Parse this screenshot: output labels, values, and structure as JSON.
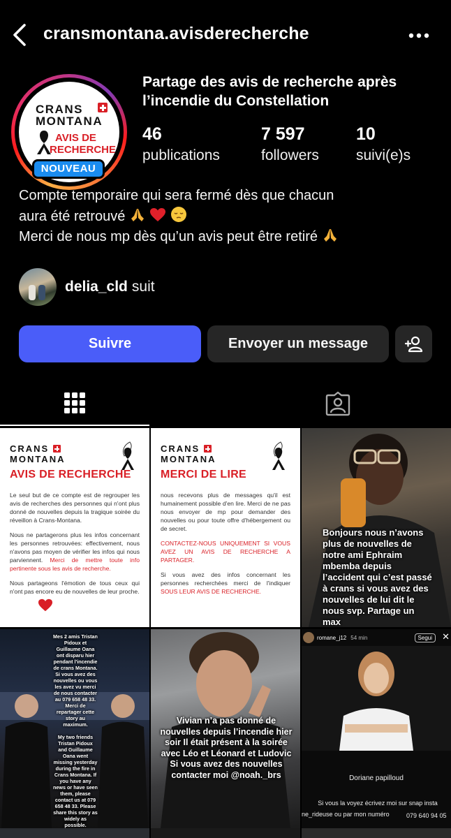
{
  "header": {
    "username": "cransmontana.avisderecherche"
  },
  "profile": {
    "logo_line1": "CRANS",
    "logo_line2": "MONTANA",
    "logo_line3": "AVIS DE",
    "logo_line4": "RECHERCHE",
    "new_badge": "NOUVEAU",
    "display_name": "Partage des avis de recherche après l’incendie du Constellation",
    "stats": {
      "posts_count": "46",
      "posts_label": "publications",
      "followers_count": "7 597",
      "followers_label": "followers",
      "following_count": "10",
      "following_label": "suivi(e)s"
    },
    "bio_line1": "Compte temporaire qui sera fermé dès que chacun",
    "bio_line2": "aura été retrouvé",
    "bio_line3": "Merci de nous mp dès qu’un avis peut être retiré",
    "followed_by_name": "delia_cld",
    "followed_by_suffix": "suit"
  },
  "actions": {
    "follow": "Suivre",
    "message": "Envoyer un message"
  },
  "posts": {
    "p1": {
      "line1": "CRANS",
      "line2": "MONTANA",
      "title": "AVIS DE RECHERCHE",
      "para1": "Le seul but de ce compte est de regrouper les avis de recherches des personnes qui n'ont plus donné de nouvelles depuis la tragique soirée du réveillon à Crans-Montana.",
      "para2a": "Nous ne partagerons plus les infos concernant les personnes retrouvées: effectivement, nous n'avons pas moyen de vérifier les infos qui nous parviennent.",
      "para2b": "Merci de mettre toute info pertinente sous les avis de recherche.",
      "para3": "Nous partageons l'émotion de tous ceux qui n'ont pas encore eu de nouvelles de leur proche."
    },
    "p2": {
      "line1": "CRANS",
      "line2": "MONTANA",
      "title": "MERCI DE LIRE",
      "para1": "nous recevons plus de messages qu'il est humainement possible d'en lire. Merci de ne pas nous envoyer de mp pour demander des nouvelles ou pour toute offre d'hébergement ou de secret.",
      "para2": "CONTACTEZ-NOUS UNIQUEMENT SI VOUS AVEZ UN AVIS DE RECHERCHE A PARTAGER.",
      "para3a": "Si vous avez des infos concernant les personnes recherchées merci de l'indiquer",
      "para3b": "SOUS LEUR AVIS DE RECHERCHE."
    },
    "p3": {
      "caption": "Bonjours nous n’avons plus de nouvelles de notre ami Ephraim mbemba depuis l’accident qui c’est passé à crans si vous avez des nouvelles de lui dit le nous svp. Partage un max"
    },
    "p4": {
      "caption_fr": "Mes 2 amis Tristan Pidoux et Guillaume Oana ont disparu hier pendant l'incendie de crans Montana. Si vous avez des nouvelles ou vous les avez vu merci de nous contacter au 079 658 48 33. Merci de repartager cette story au maximum.",
      "caption_en": "My two friends Tristan Pidoux and Guillaume Oana went missing yesterday during the fire in Crans Montana. If you have any news or have seen them, please contact us at 079 658 48 33. Please share this story as widely as possible."
    },
    "p5": {
      "caption": "Vivian n’a pas donné de nouvelles depuis l’incendie hier soir Il était présent à la soirée avec Léo et Léonard et Ludovic Si vous avez des nouvelles contacter moi @noah._brs"
    },
    "p6": {
      "story_user": "romane_j12",
      "story_time": "54 min",
      "follow_label": "Segui",
      "name": "Doriane papilloud",
      "caption1": "Si vous la voyez écrivez moi sur snap insta",
      "caption2": "ne_rideuse ou par mon numéro",
      "phone": "079 640 94 05"
    }
  },
  "colors": {
    "background": "#000000",
    "follow_button": "#4a5df9",
    "secondary_button": "#262626",
    "new_badge": "#1a8cf0",
    "brand_red": "#d91f26"
  }
}
